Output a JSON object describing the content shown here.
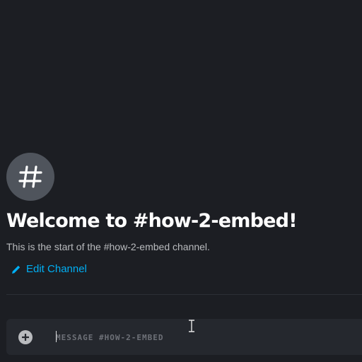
{
  "channel": {
    "icon": "hashtag-icon",
    "welcome_title": "Welcome to #how-2-embed!",
    "welcome_subtitle": "This is the start of the #how-2-embed channel.",
    "edit_label": "Edit Channel",
    "edit_icon": "pencil-icon"
  },
  "composer": {
    "placeholder": "MESSAGE #HOW-2-EMBED",
    "value": "",
    "add_icon": "plus-circle-icon"
  },
  "colors": {
    "background": "#1c1e23",
    "composer_bg": "#25282e",
    "accent_link": "#00aff4",
    "icon_circle": "#4f545c"
  }
}
